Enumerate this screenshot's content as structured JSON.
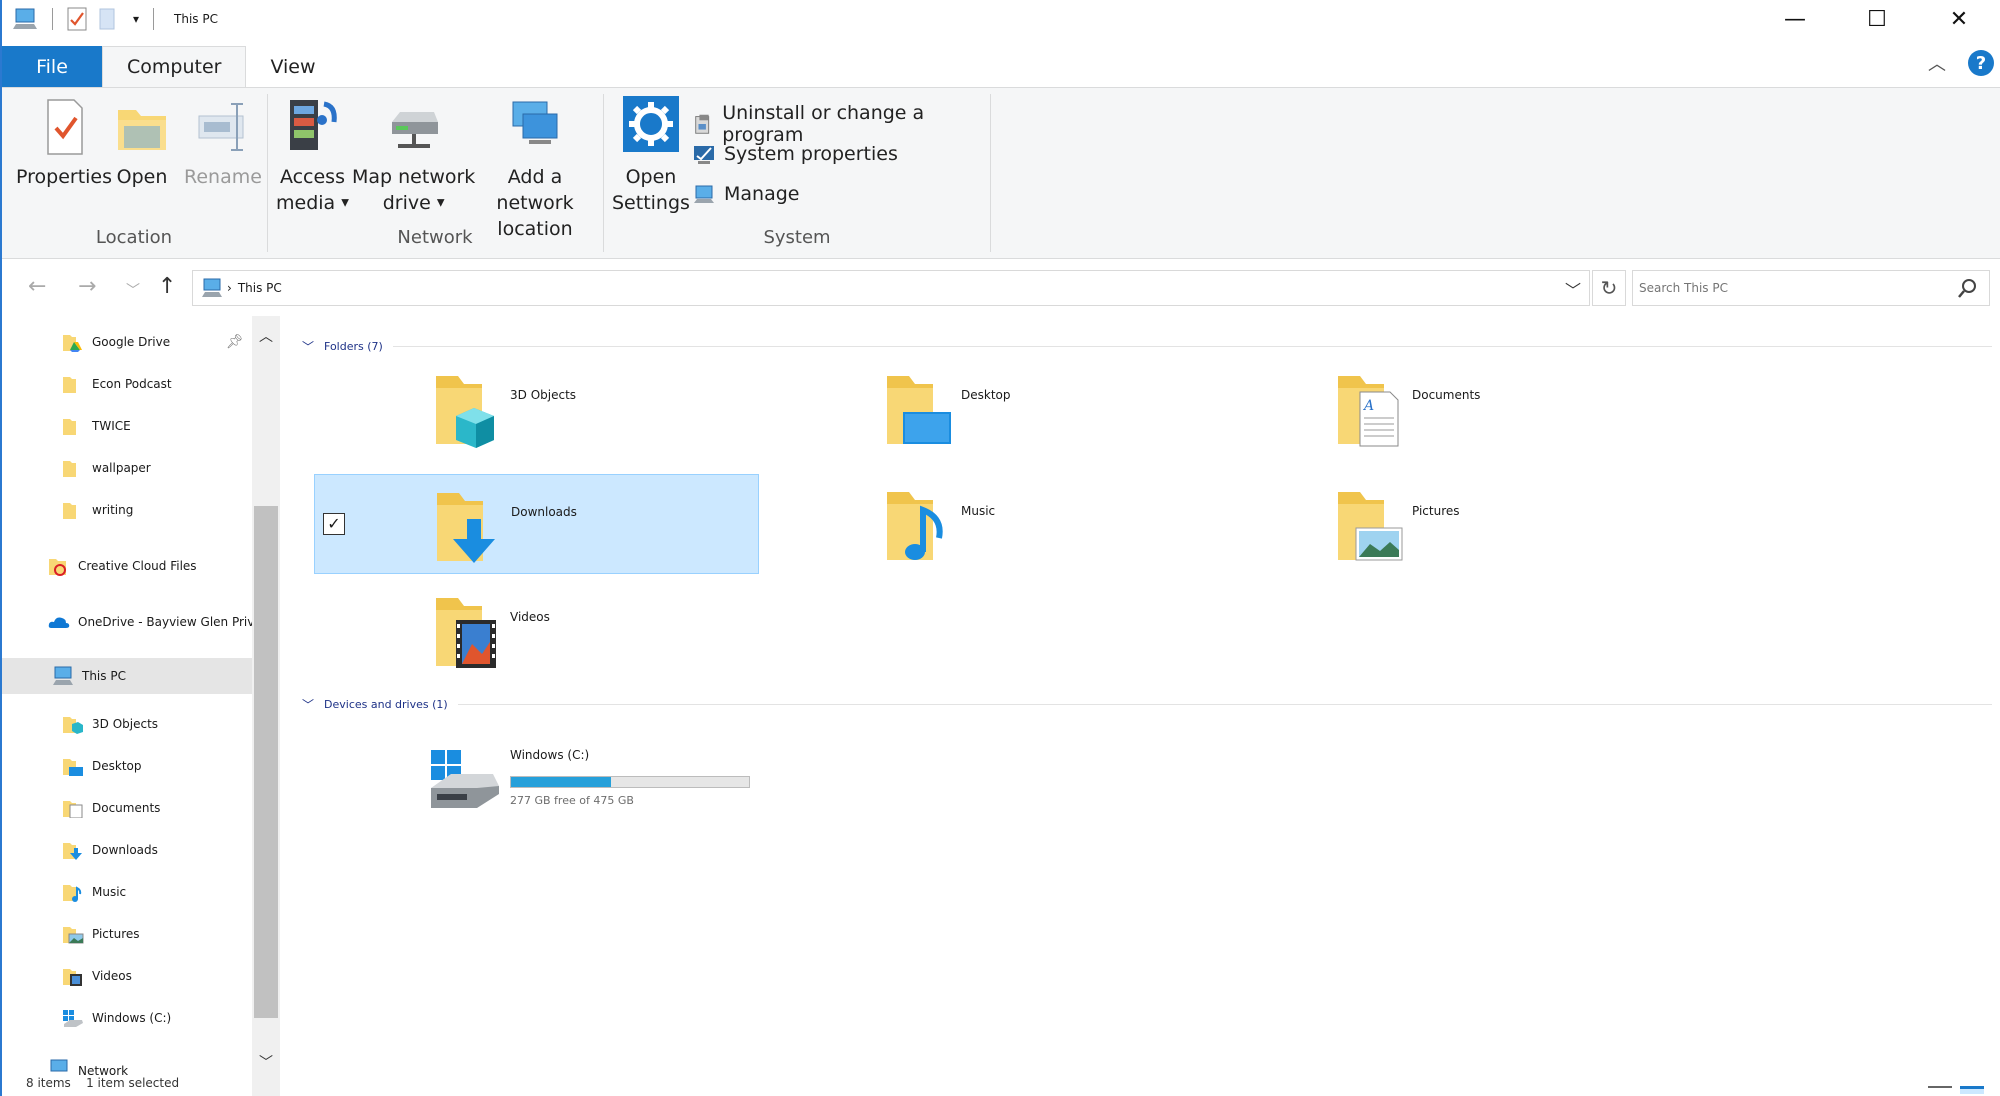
{
  "window": {
    "title": "This PC",
    "controls": {
      "minimize": "—",
      "maximize": "☐",
      "close": "✕"
    }
  },
  "ribbon": {
    "tabs": [
      {
        "label": "File"
      },
      {
        "label": "Computer"
      },
      {
        "label": "View"
      }
    ],
    "groups": {
      "location": {
        "label": "Location",
        "properties": "Properties",
        "open": "Open",
        "rename": "Rename"
      },
      "network": {
        "label": "Network",
        "access_media_1": "Access",
        "access_media_2": "media",
        "map_drive_1": "Map network",
        "map_drive_2": "drive",
        "add_location_1": "Add a network",
        "add_location_2": "location"
      },
      "system": {
        "label": "System",
        "open_settings_1": "Open",
        "open_settings_2": "Settings",
        "uninstall": "Uninstall or change a program",
        "system_properties": "System properties",
        "manage": "Manage"
      }
    },
    "help": "?"
  },
  "address": {
    "path": "This PC",
    "search_placeholder": "Search This PC"
  },
  "nav": {
    "items": [
      {
        "label": "Google Drive"
      },
      {
        "label": "Econ Podcast"
      },
      {
        "label": "TWICE"
      },
      {
        "label": "wallpaper"
      },
      {
        "label": "writing"
      },
      {
        "label": "Creative Cloud Files"
      },
      {
        "label": "OneDrive - Bayview Glen Private Scho"
      },
      {
        "label": "This PC"
      },
      {
        "label": "3D Objects"
      },
      {
        "label": "Desktop"
      },
      {
        "label": "Documents"
      },
      {
        "label": "Downloads"
      },
      {
        "label": "Music"
      },
      {
        "label": "Pictures"
      },
      {
        "label": "Videos"
      },
      {
        "label": "Windows (C:)"
      },
      {
        "label": "Network"
      }
    ]
  },
  "content": {
    "folders_header": "Folders (7)",
    "folders": [
      {
        "name": "3D Objects"
      },
      {
        "name": "Desktop"
      },
      {
        "name": "Documents"
      },
      {
        "name": "Downloads"
      },
      {
        "name": "Music"
      },
      {
        "name": "Pictures"
      },
      {
        "name": "Videos"
      }
    ],
    "devices_header": "Devices and drives (1)",
    "drive": {
      "name": "Windows (C:)",
      "free_text": "277 GB free of 475 GB",
      "used_fraction": 0.42
    }
  },
  "status": {
    "text": "8 items    1 item selected"
  },
  "colors": {
    "accent": "#1979ca",
    "selection": "#cce8ff",
    "folder": "#f8d775",
    "drive_bar": "#26a0da"
  }
}
